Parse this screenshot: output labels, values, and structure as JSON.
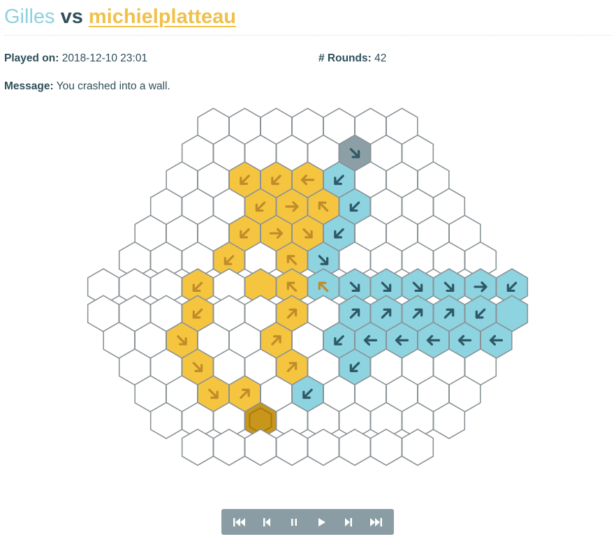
{
  "header": {
    "player1": "Gilles",
    "vs": "vs",
    "player2": "michielplatteau"
  },
  "info": {
    "played_label": "Played on:",
    "played_value": "2018-12-10 23:01",
    "rounds_label": "# Rounds:",
    "rounds_value": "42",
    "message_label": "Message:",
    "message_value": "You crashed into a wall."
  },
  "colors": {
    "player1": "#8dd3e0",
    "player2": "#f5c540",
    "crash": "#8c9fa6",
    "start": "#c8961a"
  },
  "board": {
    "rows": [
      "eeeeeee",
      "eeeeeXee",
      "eeYYYBeee",
      "eeeYYYBeee",
      "eeeYYYBeeee",
      "eeeYeYBeeeee",
      "eeeYeYYBBBBBBB",
      "eeeYeeYeBBBBBB",
      "eeYeeYeBBBBBB",
      "eeYeeYeBeeee",
      "eeYYeBeeeee",
      "eeeSeeeeee",
      "eeeeeeee"
    ]
  },
  "controls": [
    {
      "name": "first-button",
      "icon": "skip-start-icon"
    },
    {
      "name": "prev-button",
      "icon": "step-back-icon"
    },
    {
      "name": "pause-button",
      "icon": "pause-icon"
    },
    {
      "name": "play-button",
      "icon": "play-icon"
    },
    {
      "name": "next-button",
      "icon": "step-forward-icon"
    },
    {
      "name": "last-button",
      "icon": "skip-end-icon"
    }
  ]
}
